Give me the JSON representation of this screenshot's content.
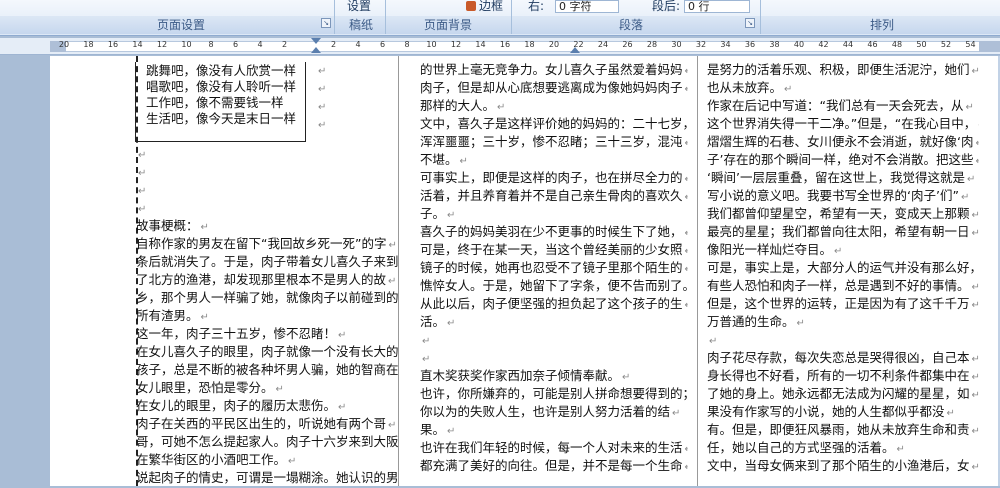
{
  "ribbon": {
    "top_items": {
      "shezhi": "设置",
      "biankuang": "边框",
      "you_label": "右:",
      "you_value": "0 字符",
      "duanhou_label": "段后:",
      "duanhou_value": "0 行"
    },
    "groups": [
      {
        "label": "页面设置"
      },
      {
        "label": "稿纸"
      },
      {
        "label": "页面背景"
      },
      {
        "label": "段落"
      },
      {
        "label": "排列"
      }
    ]
  },
  "ruler": {
    "ticks": [
      "20",
      "18",
      "16",
      "14",
      "12",
      "10",
      "8",
      "6",
      "4",
      "2",
      "",
      "2",
      "4",
      "6",
      "8",
      "10",
      "12",
      "14",
      "16",
      "18",
      "20",
      "22",
      "24",
      "26",
      "28",
      "30",
      "32",
      "34",
      "36",
      "38",
      "40",
      "42",
      "44",
      "46",
      "48",
      "50",
      "52",
      "54"
    ]
  },
  "poem": [
    "跳舞吧，像没有人欣赏一样",
    "唱歌吧，像没有人聆听一样",
    "工作吧，像不需要钱一样",
    "生活吧，像今天是末日一样"
  ],
  "col1": [
    "",
    "",
    "",
    "",
    "故事梗概：",
    "自称作家的男友在留下“我回故乡死一死”的字",
    "条后就消失了。于是，肉子带着女儿喜久子来到",
    "了北方的渔港，却发现那里根本不是男人的故",
    "乡，那个男人一样骗了她，就像肉子以前碰到的",
    "所有渣男。",
    "这一年，肉子三十五岁，惨不忍睹！",
    "在女儿喜久子的眼里，肉子就像一个没有长大的",
    "孩子，总是不断的被各种坏男人骗，她的智商在",
    "女儿眼里，恐怕是零分。",
    "在女儿的眼里，肉子的履历太悲伤。",
    "肉子在关西的平民区出生的，听说她有两个哥",
    "哥，可她不怎么提起家人。肉子十六岁来到大阪，",
    "在繁华街区的小酒吧工作。",
    "说起肉子的情史，可谓是一塌糊涂。她认识的男"
  ],
  "col2": [
    "的世界上毫无竞争力。女儿喜久子虽然爱着妈妈",
    "肉子，但是却从心底想要逃离成为像她妈妈肉子",
    "那样的大人。",
    "文中，喜久子是这样评价她的妈妈的：二十七岁，",
    "浑浑噩噩；三十岁，惨不忍睹；三十三岁，混沌",
    "不堪。",
    "可事实上，即便是这样的肉子，也在拼尽全力的",
    "活着，并且养育着并不是自己亲生骨肉的喜欢久",
    "子。",
    "喜久子的妈妈美羽在少不更事的时候生下了她，",
    "可是，终于在某一天，当这个曾经美丽的少女照",
    "镜子的时候，她再也忍受不了镜子里那个陌生的",
    "憔悴女人。于是，她留下了字条，便不告而别了。",
    "从此以后，肉子便坚强的担负起了这个孩子的生",
    "活。",
    "",
    "",
    "直木奖获奖作家西加奈子倾情奉献。",
    "也许，你所嫌弃的，可能是别人拼命想要得到的；",
    "你以为的失败人生，也许是别人努力活着的结",
    "果。",
    "也许在我们年轻的时候，每一个人对未来的生活",
    "都充满了美好的向往。但是，并不是每一个生命"
  ],
  "col3": [
    "是努力的活着乐观、积极，即便生活泥泞，她们",
    "也从未放弃。",
    "作家在后记中写道：“我们总有一天会死去，从",
    "这个世界消失得一干二净。”但是，“在我心目中，",
    "熠熠生辉的石巷、女川便永不会消逝，就好像‘肉",
    "子’存在的那个瞬间一样，绝对不会消散。把这些",
    "‘瞬间’一层层重叠，留在这世上，我觉得这就是",
    "写小说的意义吧。我要书写全世界的‘肉子’们”",
    "我们都曾仰望星空，希望有一天，变成天上那颗",
    "最亮的星星；我们都曾向往太阳，希望有朝一日",
    "像阳光一样灿烂夺目。",
    "可是，事实上是，大部分人的运气并没有那么好，",
    "有些人恐怕和肉子一样，总是遇到不好的事情。",
    "但是，这个世界的运转，正是因为有了这千千万",
    "万普通的生命。",
    "",
    "肉子花尽存款，每次失恋总是哭得很凶，自己本",
    "身长得也不好看，所有的一切不利条件都集中在",
    "了她的身上。她永远都无法成为闪耀的星星，如",
    "果没有作家写的小说，她的人生都似乎都没",
    "有。但是，即便狂风暴雨，她从未放弃生命和责",
    "任，她以自己的方式坚强的活着。",
    "文中，当母女俩来到了那个陌生的小渔港后，女"
  ],
  "return_mark": "↵"
}
